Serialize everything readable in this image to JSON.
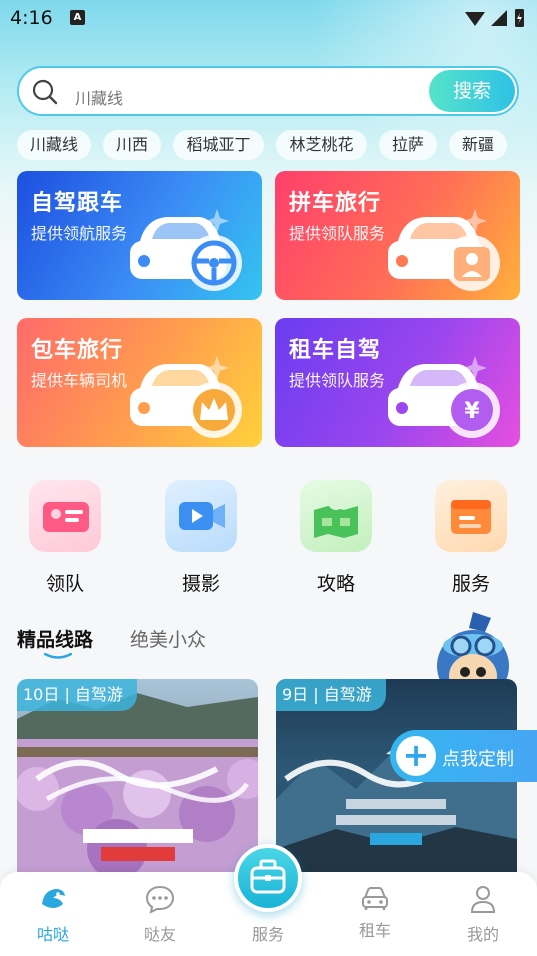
{
  "status_bar": {
    "time": "4:16",
    "notification_icon": "A"
  },
  "search": {
    "placeholder": "川藏线",
    "button_label": "搜索"
  },
  "chips": [
    "川藏线",
    "川西",
    "稻城亚丁",
    "林芝桃花",
    "拉萨",
    "新疆"
  ],
  "services": [
    {
      "title": "自驾跟车",
      "subtitle": "提供领航服务",
      "icon": "car-steering-wheel-icon"
    },
    {
      "title": "拼车旅行",
      "subtitle": "提供领队服务",
      "icon": "car-person-icon"
    },
    {
      "title": "包车旅行",
      "subtitle": "提供车辆司机",
      "icon": "car-crown-icon"
    },
    {
      "title": "租车自驾",
      "subtitle": "提供领队服务",
      "icon": "car-yuan-icon"
    }
  ],
  "quick_links": [
    {
      "label": "领队",
      "icon": "id-card-icon"
    },
    {
      "label": "摄影",
      "icon": "video-camera-icon"
    },
    {
      "label": "攻略",
      "icon": "map-pin-icon"
    },
    {
      "label": "服务",
      "icon": "folder-icon"
    }
  ],
  "tabs": {
    "active": "精品线路",
    "inactive": "绝美小众"
  },
  "routes": [
    {
      "badge": "10日 | 自驾游",
      "image": "peach-blossom-tibet-photo"
    },
    {
      "badge": "9日 | 自驾游",
      "image": "sichuan-tibet-route-photo"
    }
  ],
  "float_button": {
    "label": "点我定制"
  },
  "bottom_nav": [
    {
      "label": "咕哒",
      "icon": "bird-logo-icon",
      "active": true
    },
    {
      "label": "哒友",
      "icon": "chat-bubble-icon",
      "active": false
    },
    {
      "label": "服务",
      "icon": "briefcase-icon",
      "active": false
    },
    {
      "label": "租车",
      "icon": "car-icon",
      "active": false
    },
    {
      "label": "我的",
      "icon": "user-icon",
      "active": false
    }
  ],
  "colors": {
    "accent": "#2aa7de",
    "search_border": "#4fc9ea"
  }
}
